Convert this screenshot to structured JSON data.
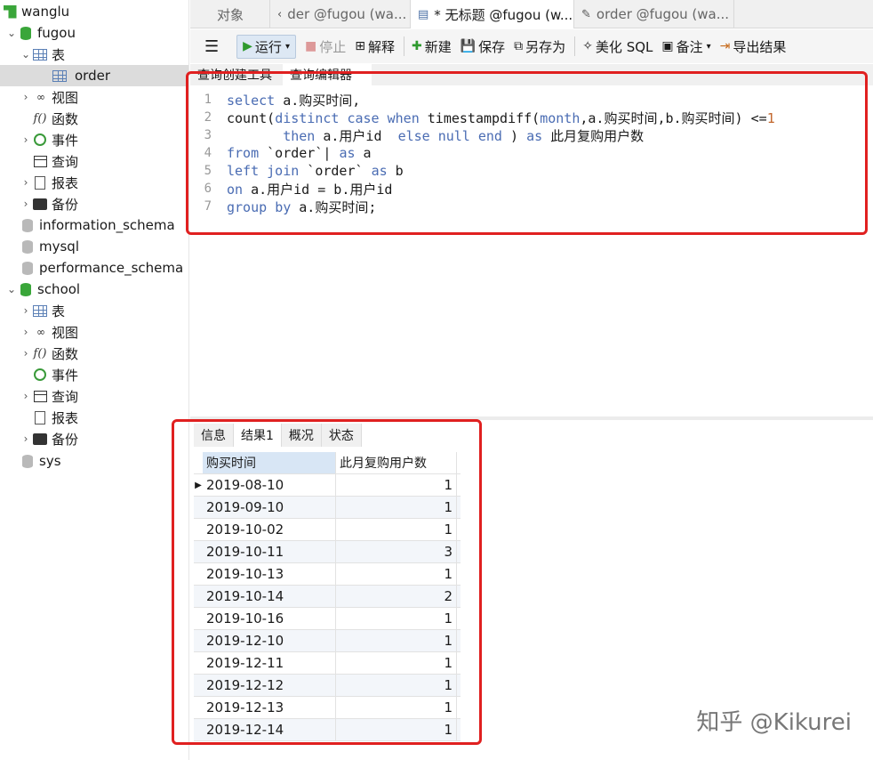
{
  "tree": {
    "connection": "wanglu",
    "db_fugou": "fugou",
    "tables_label": "表",
    "table_order": "order",
    "views": "视图",
    "functions": "函数",
    "events": "事件",
    "queries": "查询",
    "reports": "报表",
    "backups": "备份",
    "db_information_schema": "information_schema",
    "db_mysql": "mysql",
    "db_performance_schema": "performance_schema",
    "db_school": "school",
    "db_sys": "sys"
  },
  "tabs": [
    {
      "label": "对象"
    },
    {
      "label": "der @fugou (wa..."
    },
    {
      "label": "* 无标题 @fugou (w..."
    },
    {
      "label": "order @fugou (wa..."
    }
  ],
  "toolbar": {
    "run": "运行",
    "stop": "停止",
    "explain": "解释",
    "new": "新建",
    "save": "保存",
    "save_as": "另存为",
    "beautify": "美化 SQL",
    "comment": "备注",
    "export": "导出结果"
  },
  "subtabs": {
    "builder": "查询创建工具",
    "editor": "查询编辑器"
  },
  "editor": {
    "lines": [
      {
        "n": "1"
      },
      {
        "n": "2"
      },
      {
        "n": "3"
      },
      {
        "n": "4"
      },
      {
        "n": "5"
      },
      {
        "n": "6"
      },
      {
        "n": "7"
      }
    ]
  },
  "result_tabs": {
    "info": "信息",
    "result1": "结果1",
    "overview": "概况",
    "status": "状态"
  },
  "grid": {
    "columns": [
      "购买时间",
      "此月复购用户数"
    ],
    "rows": [
      [
        "2019-08-10",
        "1"
      ],
      [
        "2019-09-10",
        "1"
      ],
      [
        "2019-10-02",
        "1"
      ],
      [
        "2019-10-11",
        "3"
      ],
      [
        "2019-10-13",
        "1"
      ],
      [
        "2019-10-14",
        "2"
      ],
      [
        "2019-10-16",
        "1"
      ],
      [
        "2019-12-10",
        "1"
      ],
      [
        "2019-12-11",
        "1"
      ],
      [
        "2019-12-12",
        "1"
      ],
      [
        "2019-12-13",
        "1"
      ],
      [
        "2019-12-14",
        "1"
      ]
    ]
  },
  "signature": "知乎 @Kikurei",
  "colors": {
    "highlight_box": "#e02020",
    "keyword": "#4a6cb3",
    "db_icon": "#3aa63a"
  }
}
